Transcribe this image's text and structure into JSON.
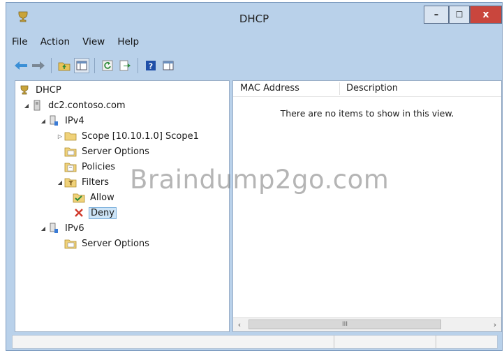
{
  "window": {
    "title": "DHCP"
  },
  "controls": {
    "minimize": "–",
    "maximize": "☐",
    "close": "x"
  },
  "menu": [
    "File",
    "Action",
    "View",
    "Help"
  ],
  "tree": {
    "root": "DHCP",
    "server": "dc2.contoso.com",
    "ipv4": "IPv4",
    "scope": "Scope [10.10.1.0] Scope1",
    "ipv4_server_options": "Server Options",
    "policies": "Policies",
    "filters": "Filters",
    "allow": "Allow",
    "deny": "Deny",
    "ipv6": "IPv6",
    "ipv6_server_options": "Server Options"
  },
  "list": {
    "columns": [
      "MAC Address",
      "Description"
    ],
    "empty_message": "There are no items to show in this view."
  },
  "scrollbar": {
    "thumb_grip": "III"
  },
  "watermark": "Braindump2go.com",
  "colors": {
    "frame": "#b9d1ea",
    "close": "#c9463d",
    "selection": "#cde4f7"
  }
}
